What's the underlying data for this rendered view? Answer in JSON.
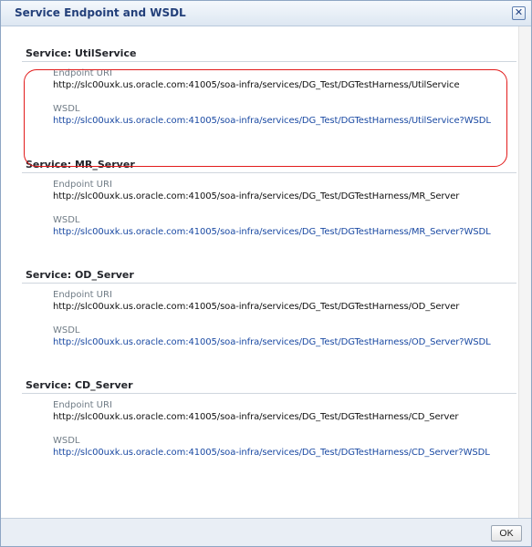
{
  "dialog": {
    "title": "Service Endpoint and WSDL",
    "close_icon": "close-icon",
    "ok_label": "OK"
  },
  "services": [
    {
      "header": "Service: UtilService",
      "endpoint_label": "Endpoint URI",
      "endpoint_value": "http://slc00uxk.us.oracle.com:41005/soa-infra/services/DG_Test/DGTestHarness/UtilService",
      "wsdl_label": "WSDL",
      "wsdl_value": "http://slc00uxk.us.oracle.com:41005/soa-infra/services/DG_Test/DGTestHarness/UtilService?WSDL"
    },
    {
      "header": "Service: MR_Server",
      "endpoint_label": "Endpoint URI",
      "endpoint_value": "http://slc00uxk.us.oracle.com:41005/soa-infra/services/DG_Test/DGTestHarness/MR_Server",
      "wsdl_label": "WSDL",
      "wsdl_value": "http://slc00uxk.us.oracle.com:41005/soa-infra/services/DG_Test/DGTestHarness/MR_Server?WSDL"
    },
    {
      "header": "Service: OD_Server",
      "endpoint_label": "Endpoint URI",
      "endpoint_value": "http://slc00uxk.us.oracle.com:41005/soa-infra/services/DG_Test/DGTestHarness/OD_Server",
      "wsdl_label": "WSDL",
      "wsdl_value": "http://slc00uxk.us.oracle.com:41005/soa-infra/services/DG_Test/DGTestHarness/OD_Server?WSDL"
    },
    {
      "header": "Service: CD_Server",
      "endpoint_label": "Endpoint URI",
      "endpoint_value": "http://slc00uxk.us.oracle.com:41005/soa-infra/services/DG_Test/DGTestHarness/CD_Server",
      "wsdl_label": "WSDL",
      "wsdl_value": "http://slc00uxk.us.oracle.com:41005/soa-infra/services/DG_Test/DGTestHarness/CD_Server?WSDL"
    }
  ],
  "colors": {
    "highlight": "#e21b1b",
    "link": "#1b4aa3",
    "title": "#23407a"
  }
}
